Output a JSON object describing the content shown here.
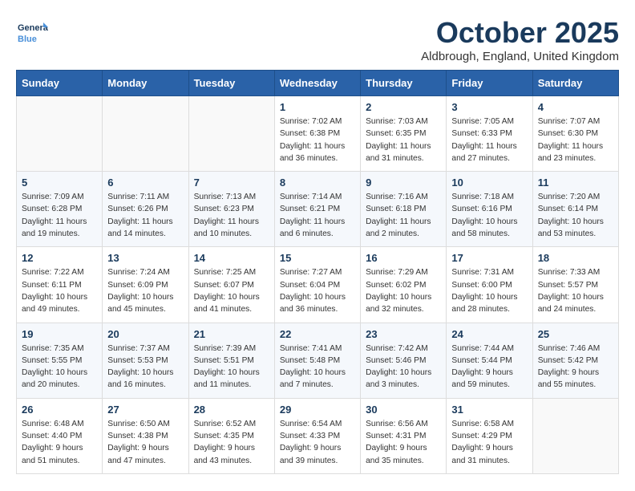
{
  "logo": {
    "line1": "General",
    "line2": "Blue"
  },
  "header": {
    "month": "October 2025",
    "location": "Aldbrough, England, United Kingdom"
  },
  "weekdays": [
    "Sunday",
    "Monday",
    "Tuesday",
    "Wednesday",
    "Thursday",
    "Friday",
    "Saturday"
  ],
  "weeks": [
    [
      {
        "day": "",
        "sunrise": "",
        "sunset": "",
        "daylight": ""
      },
      {
        "day": "",
        "sunrise": "",
        "sunset": "",
        "daylight": ""
      },
      {
        "day": "",
        "sunrise": "",
        "sunset": "",
        "daylight": ""
      },
      {
        "day": "1",
        "sunrise": "Sunrise: 7:02 AM",
        "sunset": "Sunset: 6:38 PM",
        "daylight": "Daylight: 11 hours and 36 minutes."
      },
      {
        "day": "2",
        "sunrise": "Sunrise: 7:03 AM",
        "sunset": "Sunset: 6:35 PM",
        "daylight": "Daylight: 11 hours and 31 minutes."
      },
      {
        "day": "3",
        "sunrise": "Sunrise: 7:05 AM",
        "sunset": "Sunset: 6:33 PM",
        "daylight": "Daylight: 11 hours and 27 minutes."
      },
      {
        "day": "4",
        "sunrise": "Sunrise: 7:07 AM",
        "sunset": "Sunset: 6:30 PM",
        "daylight": "Daylight: 11 hours and 23 minutes."
      }
    ],
    [
      {
        "day": "5",
        "sunrise": "Sunrise: 7:09 AM",
        "sunset": "Sunset: 6:28 PM",
        "daylight": "Daylight: 11 hours and 19 minutes."
      },
      {
        "day": "6",
        "sunrise": "Sunrise: 7:11 AM",
        "sunset": "Sunset: 6:26 PM",
        "daylight": "Daylight: 11 hours and 14 minutes."
      },
      {
        "day": "7",
        "sunrise": "Sunrise: 7:13 AM",
        "sunset": "Sunset: 6:23 PM",
        "daylight": "Daylight: 11 hours and 10 minutes."
      },
      {
        "day": "8",
        "sunrise": "Sunrise: 7:14 AM",
        "sunset": "Sunset: 6:21 PM",
        "daylight": "Daylight: 11 hours and 6 minutes."
      },
      {
        "day": "9",
        "sunrise": "Sunrise: 7:16 AM",
        "sunset": "Sunset: 6:18 PM",
        "daylight": "Daylight: 11 hours and 2 minutes."
      },
      {
        "day": "10",
        "sunrise": "Sunrise: 7:18 AM",
        "sunset": "Sunset: 6:16 PM",
        "daylight": "Daylight: 10 hours and 58 minutes."
      },
      {
        "day": "11",
        "sunrise": "Sunrise: 7:20 AM",
        "sunset": "Sunset: 6:14 PM",
        "daylight": "Daylight: 10 hours and 53 minutes."
      }
    ],
    [
      {
        "day": "12",
        "sunrise": "Sunrise: 7:22 AM",
        "sunset": "Sunset: 6:11 PM",
        "daylight": "Daylight: 10 hours and 49 minutes."
      },
      {
        "day": "13",
        "sunrise": "Sunrise: 7:24 AM",
        "sunset": "Sunset: 6:09 PM",
        "daylight": "Daylight: 10 hours and 45 minutes."
      },
      {
        "day": "14",
        "sunrise": "Sunrise: 7:25 AM",
        "sunset": "Sunset: 6:07 PM",
        "daylight": "Daylight: 10 hours and 41 minutes."
      },
      {
        "day": "15",
        "sunrise": "Sunrise: 7:27 AM",
        "sunset": "Sunset: 6:04 PM",
        "daylight": "Daylight: 10 hours and 36 minutes."
      },
      {
        "day": "16",
        "sunrise": "Sunrise: 7:29 AM",
        "sunset": "Sunset: 6:02 PM",
        "daylight": "Daylight: 10 hours and 32 minutes."
      },
      {
        "day": "17",
        "sunrise": "Sunrise: 7:31 AM",
        "sunset": "Sunset: 6:00 PM",
        "daylight": "Daylight: 10 hours and 28 minutes."
      },
      {
        "day": "18",
        "sunrise": "Sunrise: 7:33 AM",
        "sunset": "Sunset: 5:57 PM",
        "daylight": "Daylight: 10 hours and 24 minutes."
      }
    ],
    [
      {
        "day": "19",
        "sunrise": "Sunrise: 7:35 AM",
        "sunset": "Sunset: 5:55 PM",
        "daylight": "Daylight: 10 hours and 20 minutes."
      },
      {
        "day": "20",
        "sunrise": "Sunrise: 7:37 AM",
        "sunset": "Sunset: 5:53 PM",
        "daylight": "Daylight: 10 hours and 16 minutes."
      },
      {
        "day": "21",
        "sunrise": "Sunrise: 7:39 AM",
        "sunset": "Sunset: 5:51 PM",
        "daylight": "Daylight: 10 hours and 11 minutes."
      },
      {
        "day": "22",
        "sunrise": "Sunrise: 7:41 AM",
        "sunset": "Sunset: 5:48 PM",
        "daylight": "Daylight: 10 hours and 7 minutes."
      },
      {
        "day": "23",
        "sunrise": "Sunrise: 7:42 AM",
        "sunset": "Sunset: 5:46 PM",
        "daylight": "Daylight: 10 hours and 3 minutes."
      },
      {
        "day": "24",
        "sunrise": "Sunrise: 7:44 AM",
        "sunset": "Sunset: 5:44 PM",
        "daylight": "Daylight: 9 hours and 59 minutes."
      },
      {
        "day": "25",
        "sunrise": "Sunrise: 7:46 AM",
        "sunset": "Sunset: 5:42 PM",
        "daylight": "Daylight: 9 hours and 55 minutes."
      }
    ],
    [
      {
        "day": "26",
        "sunrise": "Sunrise: 6:48 AM",
        "sunset": "Sunset: 4:40 PM",
        "daylight": "Daylight: 9 hours and 51 minutes."
      },
      {
        "day": "27",
        "sunrise": "Sunrise: 6:50 AM",
        "sunset": "Sunset: 4:38 PM",
        "daylight": "Daylight: 9 hours and 47 minutes."
      },
      {
        "day": "28",
        "sunrise": "Sunrise: 6:52 AM",
        "sunset": "Sunset: 4:35 PM",
        "daylight": "Daylight: 9 hours and 43 minutes."
      },
      {
        "day": "29",
        "sunrise": "Sunrise: 6:54 AM",
        "sunset": "Sunset: 4:33 PM",
        "daylight": "Daylight: 9 hours and 39 minutes."
      },
      {
        "day": "30",
        "sunrise": "Sunrise: 6:56 AM",
        "sunset": "Sunset: 4:31 PM",
        "daylight": "Daylight: 9 hours and 35 minutes."
      },
      {
        "day": "31",
        "sunrise": "Sunrise: 6:58 AM",
        "sunset": "Sunset: 4:29 PM",
        "daylight": "Daylight: 9 hours and 31 minutes."
      },
      {
        "day": "",
        "sunrise": "",
        "sunset": "",
        "daylight": ""
      }
    ]
  ]
}
